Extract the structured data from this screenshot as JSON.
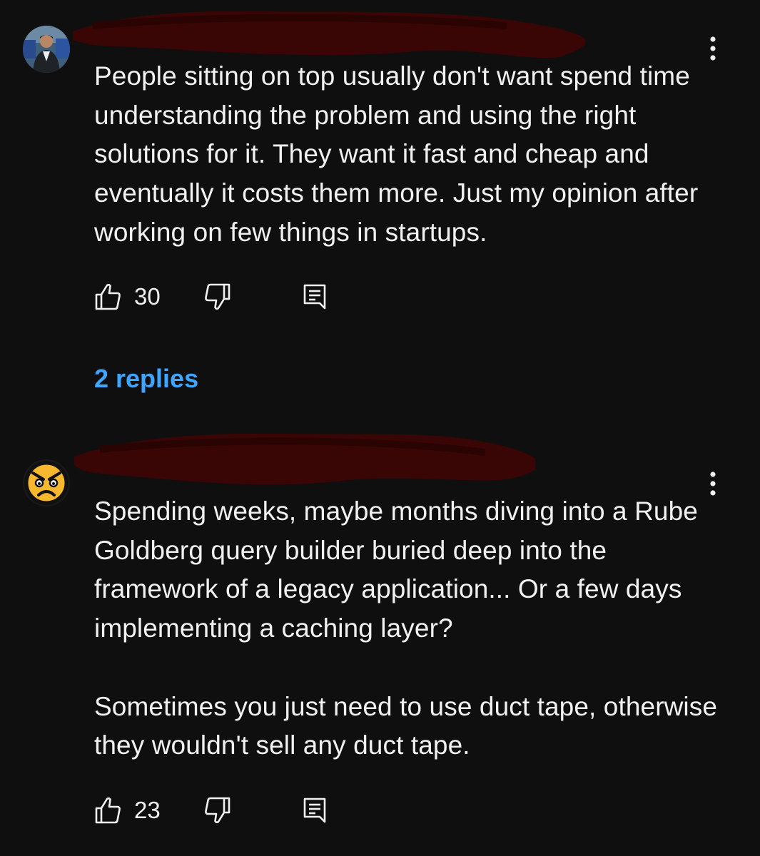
{
  "comments": [
    {
      "text": "People sitting on top usually don't want spend time understanding the problem and using the right solutions for it. They want it fast and cheap and eventually it costs them more. Just my opinion after working on few things in startups.",
      "likes": "30",
      "replies_label": "2 replies"
    },
    {
      "text": "Spending weeks, maybe months diving into a Rube Goldberg query builder buried deep into the framework of a legacy application... Or a few days implementing a caching layer?\n\nSometimes you just need to use duct tape, otherwise they wouldn't sell any duct tape.",
      "likes": "23"
    }
  ],
  "icons": {
    "like": "thumbs-up-icon",
    "dislike": "thumbs-down-icon",
    "reply": "reply-comment-icon",
    "more": "more-vertical-icon",
    "avatar_2": "angry-face-emoji"
  },
  "colors": {
    "background": "#0f0f0f",
    "text": "#f1f1f1",
    "link": "#3ea6ff",
    "redaction": "#3a0605"
  }
}
